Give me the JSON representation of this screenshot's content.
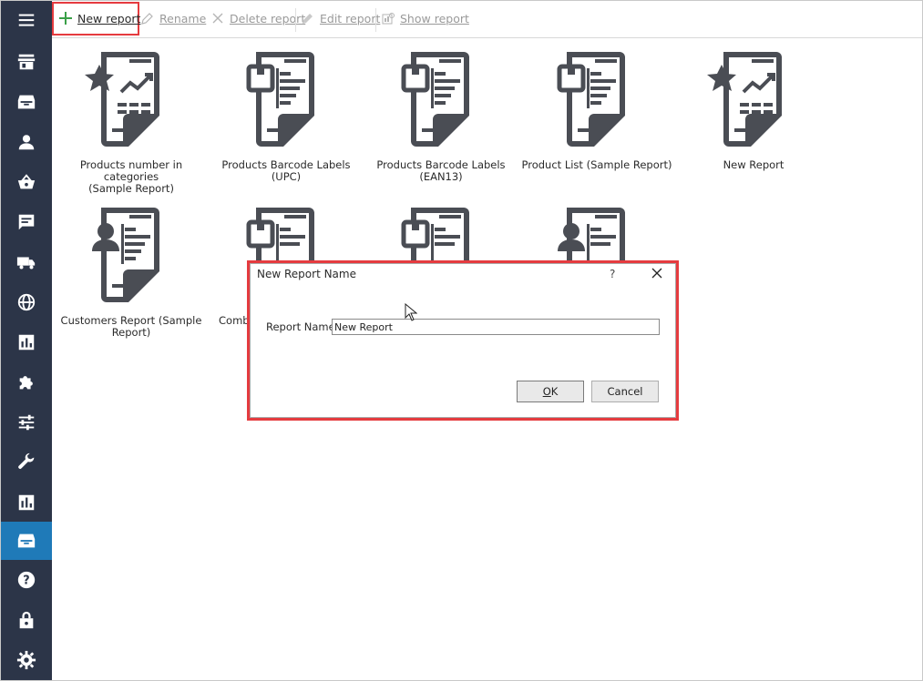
{
  "toolbar": {
    "new_report": "New report",
    "rename": "Rename",
    "delete_report": "Delete report",
    "edit_report": "Edit report",
    "show_report": "Show report"
  },
  "sidebar": {
    "items": [
      {
        "icon": "menu-icon"
      },
      {
        "icon": "store-icon"
      },
      {
        "icon": "inbox-icon"
      },
      {
        "icon": "user-icon"
      },
      {
        "icon": "basket-icon"
      },
      {
        "icon": "message-icon"
      },
      {
        "icon": "truck-icon"
      },
      {
        "icon": "globe-icon"
      },
      {
        "icon": "bar-chart-icon"
      },
      {
        "icon": "puzzle-icon"
      },
      {
        "icon": "sliders-icon"
      },
      {
        "icon": "wrench-icon"
      },
      {
        "icon": "reports-icon"
      },
      {
        "icon": "archive-icon",
        "active": true
      },
      {
        "icon": "help-icon"
      },
      {
        "icon": "lock-icon"
      },
      {
        "icon": "gear-icon"
      }
    ]
  },
  "reports": [
    {
      "label_line1": "Products number in categories",
      "label_line2": "(Sample Report)",
      "icon": "star-chart-report-icon"
    },
    {
      "label_line1": "Products Barcode Labels (UPC)",
      "label_line2": "",
      "icon": "box-report-icon"
    },
    {
      "label_line1": "Products Barcode Labels (EAN13)",
      "label_line2": "",
      "icon": "box-report-icon"
    },
    {
      "label_line1": "Product List (Sample Report)",
      "label_line2": "",
      "icon": "box-report-icon"
    },
    {
      "label_line1": "New Report",
      "label_line2": "",
      "icon": "star-chart-report-icon"
    },
    {
      "label_line1": "Customers Report (Sample",
      "label_line2": "Report)",
      "icon": "person-report-icon"
    },
    {
      "label_line1": "Combi",
      "label_line2": "",
      "icon": "box-report-icon"
    },
    {
      "label_line1": "",
      "label_line2": "",
      "icon": "box-report-icon"
    },
    {
      "label_line1": "",
      "label_line2": "",
      "icon": "person-report-icon"
    }
  ],
  "dialog": {
    "title": "New Report Name",
    "help": "?",
    "field_label": "Report Name",
    "field_value": "New Report",
    "ok_label_underlined": "O",
    "ok_label_rest": "K",
    "cancel_label": "Cancel"
  },
  "colors": {
    "sidebar": "#2c3548",
    "sidebar_active": "#1f7ab8",
    "highlight": "#e53b3f",
    "icon": "#4a4d54"
  }
}
